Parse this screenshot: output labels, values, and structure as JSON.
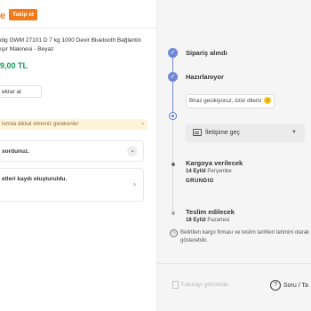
{
  "header": {
    "brand_fragment": "e",
    "follow_label": "Takip et"
  },
  "product": {
    "name": "dig GWM 27101 D 7 kg 1000 Devir Bluetooth Bağlantılı\nışır Makinesi - Beyaz",
    "price": "9,00 TL"
  },
  "return_button": {
    "label": "ekrar al"
  },
  "notice": {
    "text": "lumda dikkat etmeniz gerekenler",
    "chevron": "›"
  },
  "cards": [
    {
      "text": "sordunuz.",
      "chevron": "⌄"
    },
    {
      "text": "etleri kaydı oluşturuldu.",
      "chevron": "›"
    }
  ],
  "timeline": {
    "steps": [
      {
        "title": "Sipariş alındı"
      },
      {
        "title": "Hazırlanıyor",
        "message": "Biraz gecikiyoruz, özür dileriz",
        "emoji": "☺"
      },
      {
        "title": "Kargoya verilecek",
        "date": "14 Eylül",
        "day": "Perşembe",
        "carrier": "GRUNDIG"
      },
      {
        "title": "Teslim edilecek",
        "date": "18 Eylül",
        "day": "Pazartesi"
      }
    ],
    "contact": {
      "label": "İletişime geç",
      "caret": "▼"
    },
    "info": "Belirtilen kargo firması ve teslim tarihleri tahmini olarak gösterebilir."
  },
  "footer": {
    "invoice_label": "Faturayı görüntüle",
    "qa_label": "Soru / Ta"
  },
  "colors": {
    "accent": "#f27a1a",
    "price": "#0f9d58",
    "timeline": "#6f86d6"
  }
}
